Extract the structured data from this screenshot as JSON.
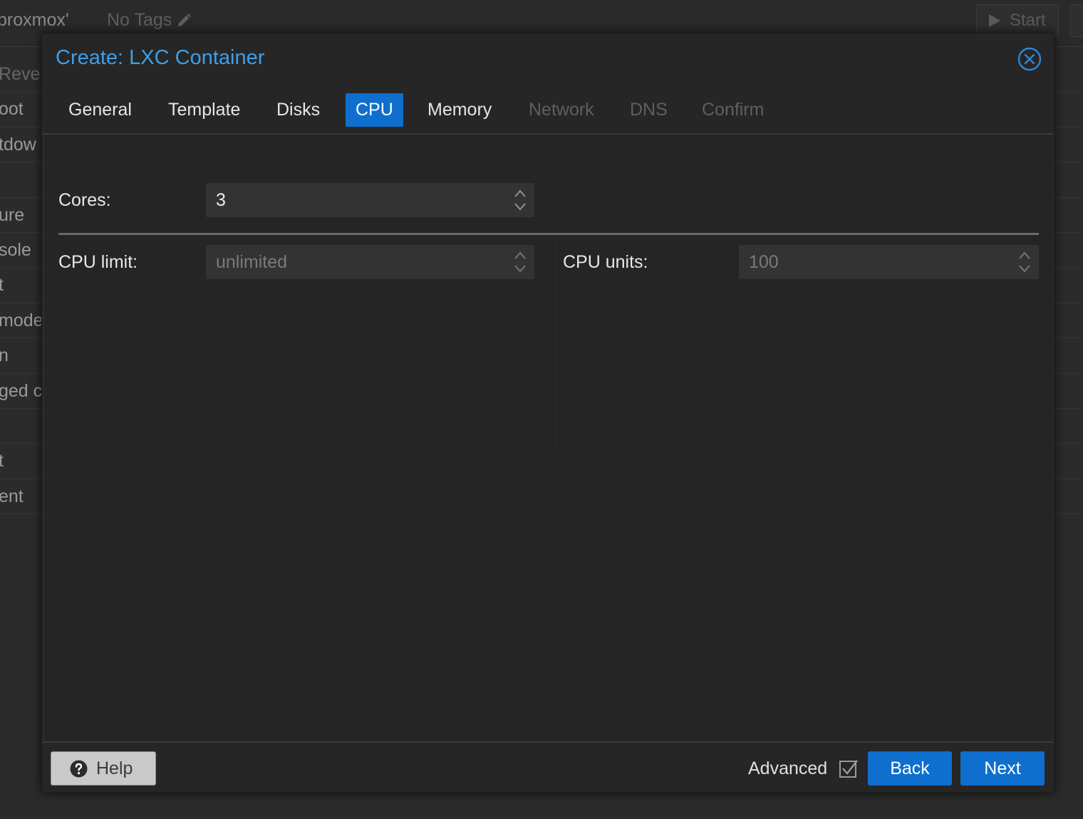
{
  "background": {
    "title": "proxmox'",
    "tags": "No Tags",
    "start_button": "Start",
    "nav_items": [
      "Reve",
      "oot",
      "tdow",
      "",
      "ure",
      "sole",
      "t",
      "mode",
      "n",
      "ged c",
      "",
      "t",
      "ent"
    ]
  },
  "dialog": {
    "title": "Create: LXC Container",
    "tabs": [
      {
        "label": "General",
        "state": "normal"
      },
      {
        "label": "Template",
        "state": "normal"
      },
      {
        "label": "Disks",
        "state": "normal"
      },
      {
        "label": "CPU",
        "state": "active"
      },
      {
        "label": "Memory",
        "state": "normal"
      },
      {
        "label": "Network",
        "state": "disabled"
      },
      {
        "label": "DNS",
        "state": "disabled"
      },
      {
        "label": "Confirm",
        "state": "disabled"
      }
    ],
    "cores": {
      "label": "Cores:",
      "value": "3"
    },
    "cpu_limit": {
      "label": "CPU limit:",
      "value": "",
      "placeholder": "unlimited"
    },
    "cpu_units": {
      "label": "CPU units:",
      "value": "",
      "placeholder": "100"
    },
    "footer": {
      "help_label": "Help",
      "advanced_label": "Advanced",
      "advanced_checked": true,
      "back_label": "Back",
      "next_label": "Next"
    }
  },
  "colors": {
    "accent": "#0f6fce",
    "title": "#3d9ee8",
    "background": "#262626"
  }
}
